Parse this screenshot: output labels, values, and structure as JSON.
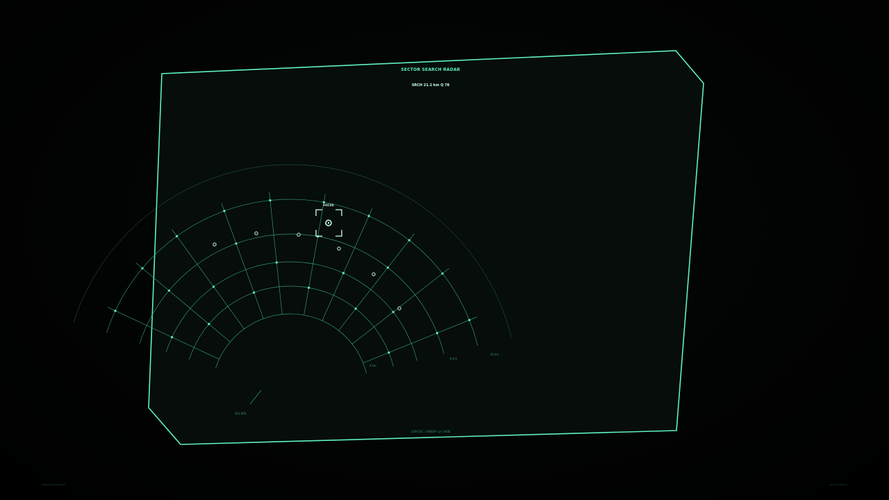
{
  "panel": {
    "title": "SECTOR SEARCH RADAR",
    "readout": "SRCH 21.1 km   Q 78",
    "focus_label": "FOCUS",
    "footer": "LOW SEC  /  SWEEP  /  pri 0008",
    "heading_label": "363.960"
  },
  "range_labels": [
    "4 km",
    "8 km",
    "10 km"
  ],
  "corner_labels": {
    "left": "RADAR PASSIVE MODE",
    "right": "SECTOR GRID 01"
  },
  "colors": {
    "accent": "#5ff0c0",
    "grid": "#4fc9a0",
    "panel_bg": "#060d0a",
    "page_bg": "#000000",
    "marker": "#c8fff0"
  }
}
